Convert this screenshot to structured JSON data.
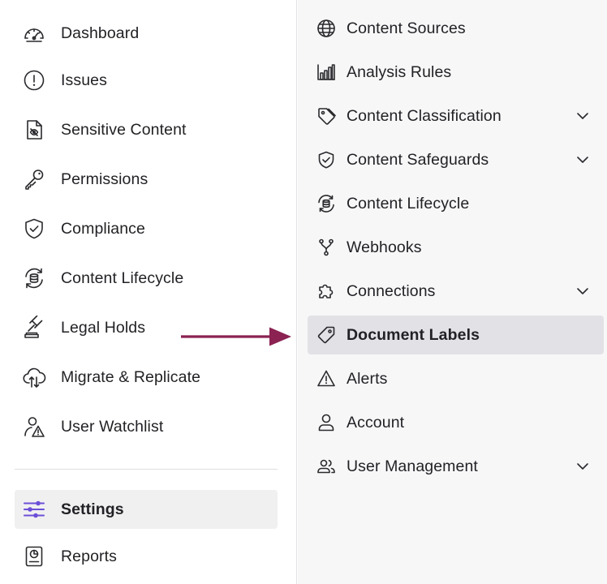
{
  "left_nav": {
    "items": [
      {
        "label": "Dashboard",
        "icon": "gauge-icon"
      },
      {
        "label": "Issues",
        "icon": "alert-circle-icon"
      },
      {
        "label": "Sensitive Content",
        "icon": "file-hidden-icon"
      },
      {
        "label": "Permissions",
        "icon": "key-icon"
      },
      {
        "label": "Compliance",
        "icon": "shield-check-icon"
      },
      {
        "label": "Content Lifecycle",
        "icon": "database-cycle-icon"
      },
      {
        "label": "Legal Holds",
        "icon": "gavel-icon"
      },
      {
        "label": "Migrate & Replicate",
        "icon": "cloud-transfer-icon"
      },
      {
        "label": "User Watchlist",
        "icon": "user-warning-icon"
      }
    ],
    "settings_label": "Settings",
    "reports_label": "Reports",
    "accent_color": "#6b4fd8"
  },
  "right_nav": {
    "items": [
      {
        "label": "Content Sources",
        "icon": "globe-icon",
        "expandable": false
      },
      {
        "label": "Analysis Rules",
        "icon": "bar-chart-icon",
        "expandable": false
      },
      {
        "label": "Content Classification",
        "icon": "tag-icon",
        "expandable": true
      },
      {
        "label": "Content Safeguards",
        "icon": "shield-check-icon",
        "expandable": true
      },
      {
        "label": "Content Lifecycle",
        "icon": "database-cycle-icon",
        "expandable": false
      },
      {
        "label": "Webhooks",
        "icon": "webhook-icon",
        "expandable": false
      },
      {
        "label": "Connections",
        "icon": "puzzle-icon",
        "expandable": true
      },
      {
        "label": "Document Labels",
        "icon": "label-tag-icon",
        "expandable": false,
        "active": true
      },
      {
        "label": "Alerts",
        "icon": "warning-triangle-icon",
        "expandable": false
      },
      {
        "label": "Account",
        "icon": "user-icon",
        "expandable": false
      },
      {
        "label": "User Management",
        "icon": "users-icon",
        "expandable": true
      }
    ]
  },
  "annotation": {
    "arrow_color": "#8b2252"
  }
}
